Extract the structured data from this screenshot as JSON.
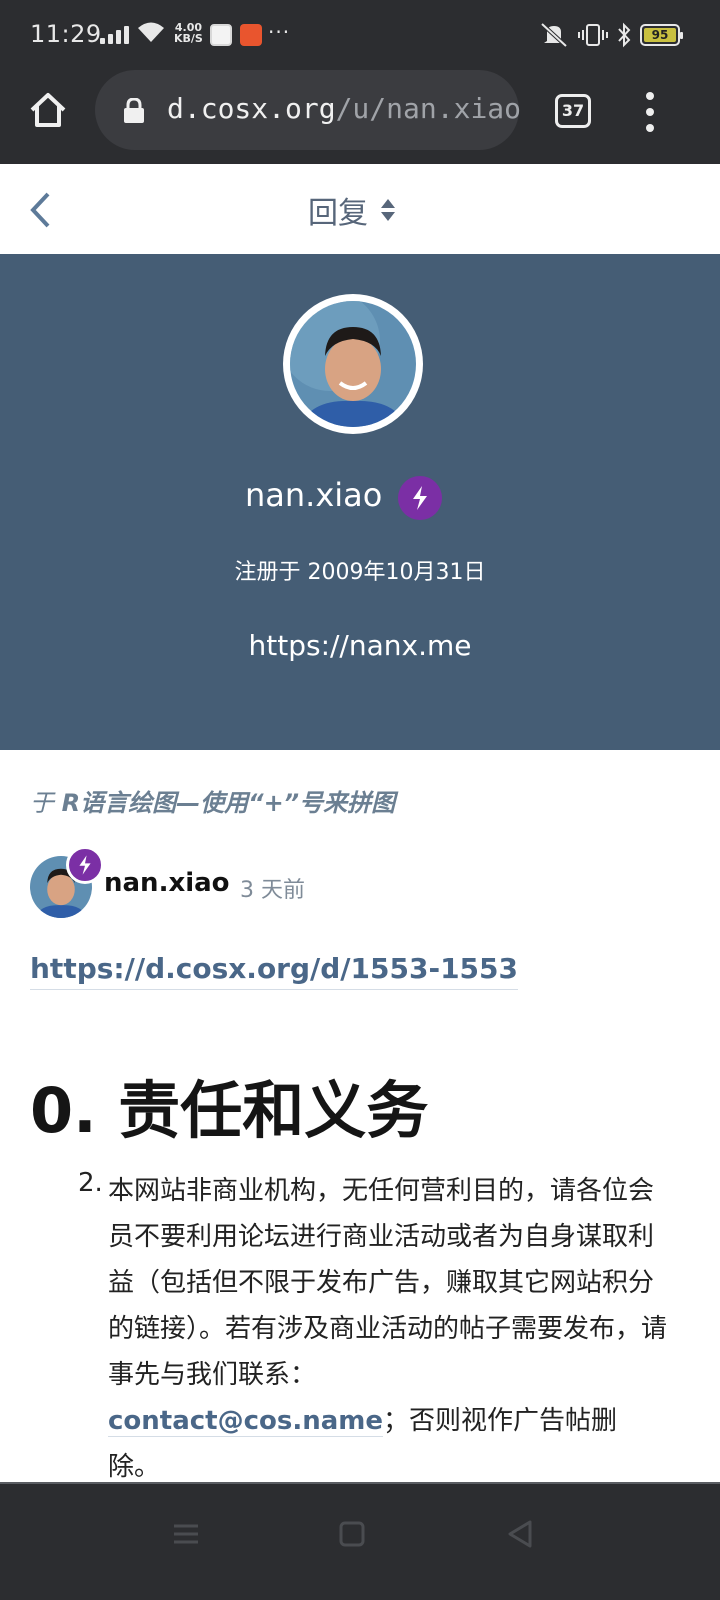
{
  "status_bar": {
    "time": "11:29",
    "net_speed_value": "4.00",
    "net_speed_unit": "KB/S",
    "overflow": "···",
    "battery": "95"
  },
  "browser": {
    "url_domain": "d.cosx.org",
    "url_path": "/u/nan.xiao",
    "tab_count": "37"
  },
  "header": {
    "sort_label": "回复"
  },
  "profile": {
    "username": "nan.xiao",
    "joined": "注册于 2009年10月31日",
    "website": "https://nanx.me"
  },
  "post": {
    "context_prefix": "于 ",
    "context_title": "R语言绘图—使用“+”号来拼图",
    "author": "nan.xiao",
    "time_ago": "3 天前",
    "link": "https://d.cosx.org/d/1553-1553",
    "heading": "0. 责任和义务",
    "list_number": "2.",
    "list_text": "本网站非商业机构，无任何营利目的，请各位会员不要利用论坛进行商业活动或者为自身谋取利益（包括但不限于发布广告，赚取其它网站积分的链接）。若有涉及商业活动的帖子需要发布，请事先与我们联系：",
    "email": "contact@cos.name",
    "list_tail": "；否则视作广告帖删除。"
  },
  "colors": {
    "hero_bg": "#455d75",
    "badge": "#7b2fa5",
    "link": "#4a6788",
    "system_bar": "#2c2d30"
  },
  "icons": [
    "home-icon",
    "lock-icon",
    "tabs-icon",
    "more-icon",
    "back-icon",
    "sort-icon",
    "lightning-icon",
    "menu-nav-icon",
    "home-nav-icon",
    "back-nav-icon"
  ]
}
